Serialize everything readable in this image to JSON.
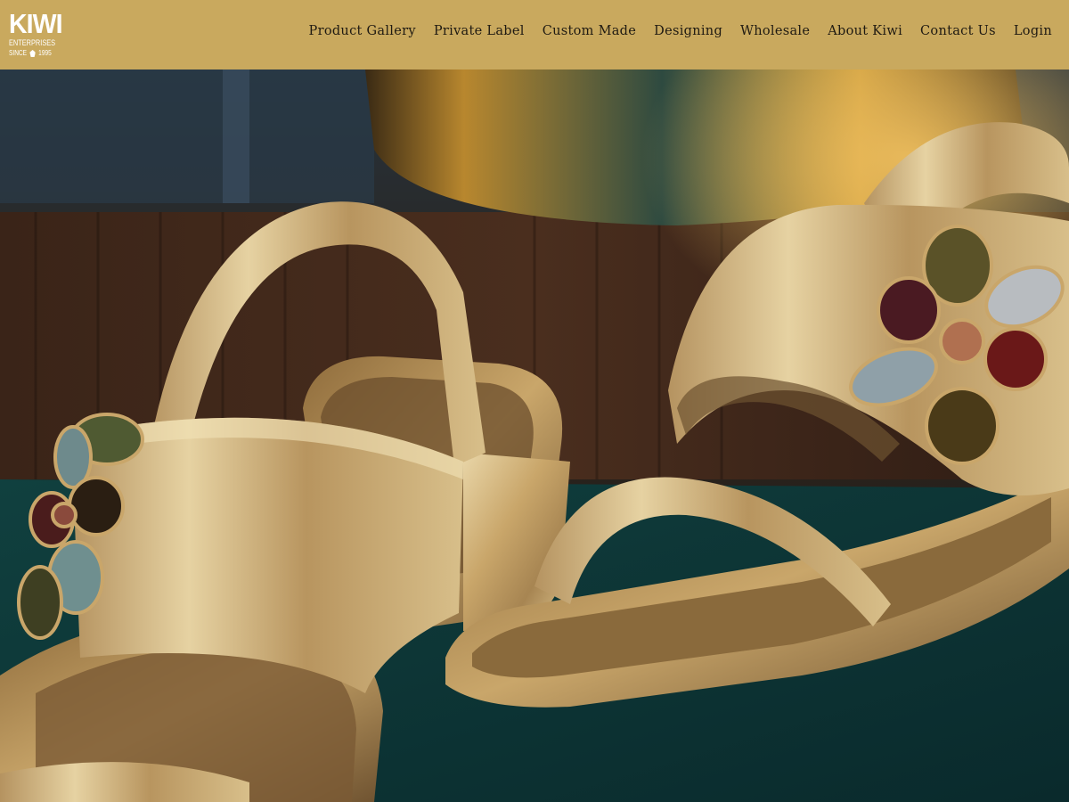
{
  "logo": {
    "word": "KIWI",
    "sub": "ENTERPRISES",
    "since_label": "SINCE",
    "year": "1995"
  },
  "nav": {
    "items": [
      "Product Gallery",
      "Private Label",
      "Custom Made",
      "Designing",
      "Wholesale",
      "About Kiwi",
      "Contact Us",
      "Login"
    ]
  },
  "colors": {
    "header_bg": "#c9a95e",
    "nav_text": "#1f1a12",
    "logo_text": "#ffffff"
  }
}
